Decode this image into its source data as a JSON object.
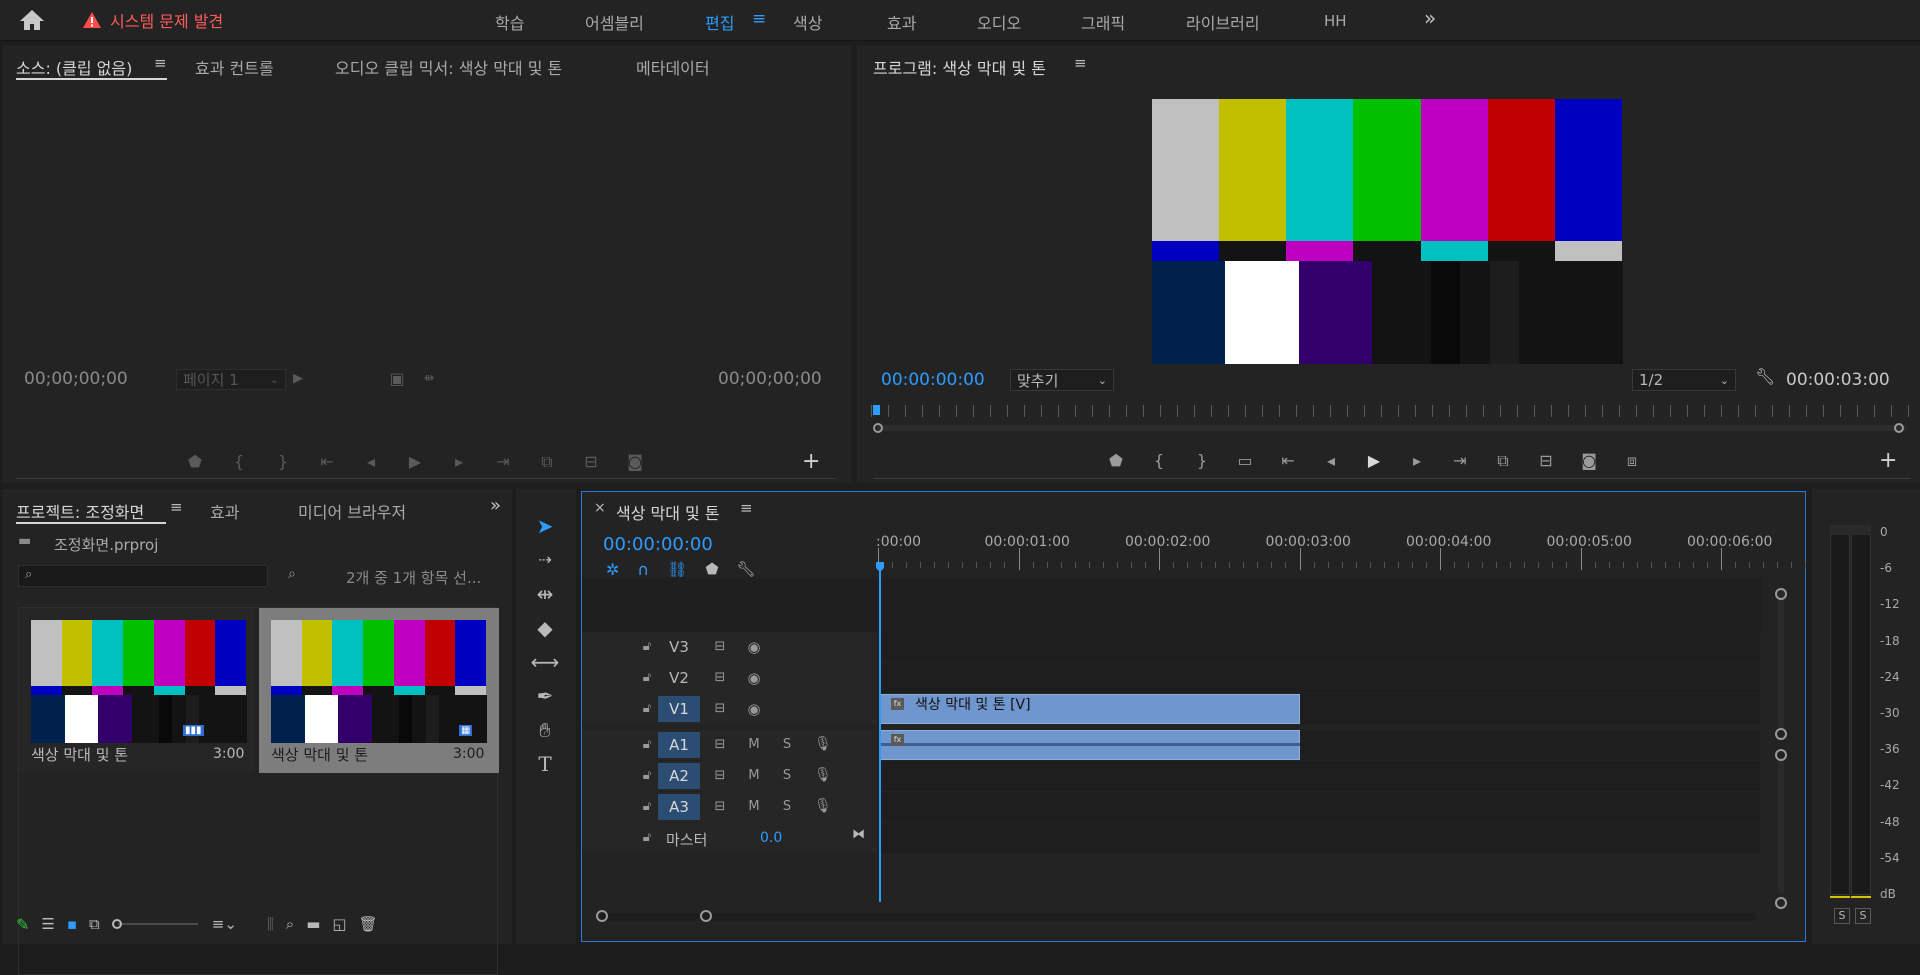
{
  "topbar": {
    "issue_text": "시스템 문제 발견",
    "tabs": [
      "학습",
      "어셈블리",
      "편집",
      "색상",
      "효과",
      "오디오",
      "그래픽",
      "라이브러리",
      "HH"
    ],
    "active_tab": "편집",
    "overflow_label": "»"
  },
  "source_panel": {
    "tabs": [
      "소스: (클립 없음)",
      "효과 컨트롤",
      "오디오 클립 믹서: 색상 막대 및 톤",
      "메타데이터"
    ],
    "tc_in": "00;00;00;00",
    "tc_out": "00;00;00;00",
    "page_label": "페이지 1"
  },
  "program_panel": {
    "title": "프로그램: 색상 막대 및 톤",
    "tc_current": "00:00:00:00",
    "fit_label": "맞추기",
    "resolution": "1/2",
    "tc_duration": "00:00:03:00"
  },
  "project_panel": {
    "tabs": [
      "프로젝트: 조정화면",
      "효과",
      "미디어 브라우저"
    ],
    "project_file": "조정화면.prproj",
    "search_placeholder": "",
    "selection_info": "2개 중 1개 항목 선...",
    "items": [
      {
        "name": "색상 막대 및 톤",
        "duration": "3:00"
      },
      {
        "name": "색상 막대 및 톤",
        "duration": "3:00"
      }
    ]
  },
  "timeline": {
    "sequence_name": "색상 막대 및 톤",
    "timecode": "00:00:00:00",
    "ruler": [
      ":00:00",
      "00:00:01:00",
      "00:00:02:00",
      "00:00:03:00",
      "00:00:04:00",
      "00:00:05:00",
      "00:00:06:00"
    ],
    "video_tracks": [
      "V3",
      "V2",
      "V1"
    ],
    "audio_tracks": [
      "A1",
      "A2",
      "A3"
    ],
    "master_label": "마스터",
    "master_value": "0.0",
    "video_clip_label": "색상 막대 및 톤 [V]",
    "fx_label": "fx",
    "audio_track_buttons": [
      "M",
      "S"
    ]
  },
  "meter": {
    "scale": [
      "0",
      "-6",
      "-12",
      "-18",
      "-24",
      "-30",
      "-36",
      "-42",
      "-48",
      "-54",
      "dB"
    ],
    "solo_buttons": [
      "S",
      "S"
    ]
  },
  "colors": {
    "accent": "#2d9cff",
    "clip_video": "#6f96cd",
    "clip_audio": "#6f96cd",
    "issue": "#ff5b5b"
  },
  "color_bars": {
    "top": [
      "#c0c0c0",
      "#c0c000",
      "#00c0c0",
      "#00c000",
      "#c000c0",
      "#c00000",
      "#0000c0"
    ],
    "middle": [
      "#0000c0",
      "#131313",
      "#c000c0",
      "#131313",
      "#00c0c0",
      "#131313",
      "#c0c0c0"
    ],
    "bottom": [
      "#00214c",
      "#ffffff",
      "#32006a",
      "#131313",
      "#090909",
      "#131313",
      "#1d1d1d",
      "#131313"
    ]
  }
}
